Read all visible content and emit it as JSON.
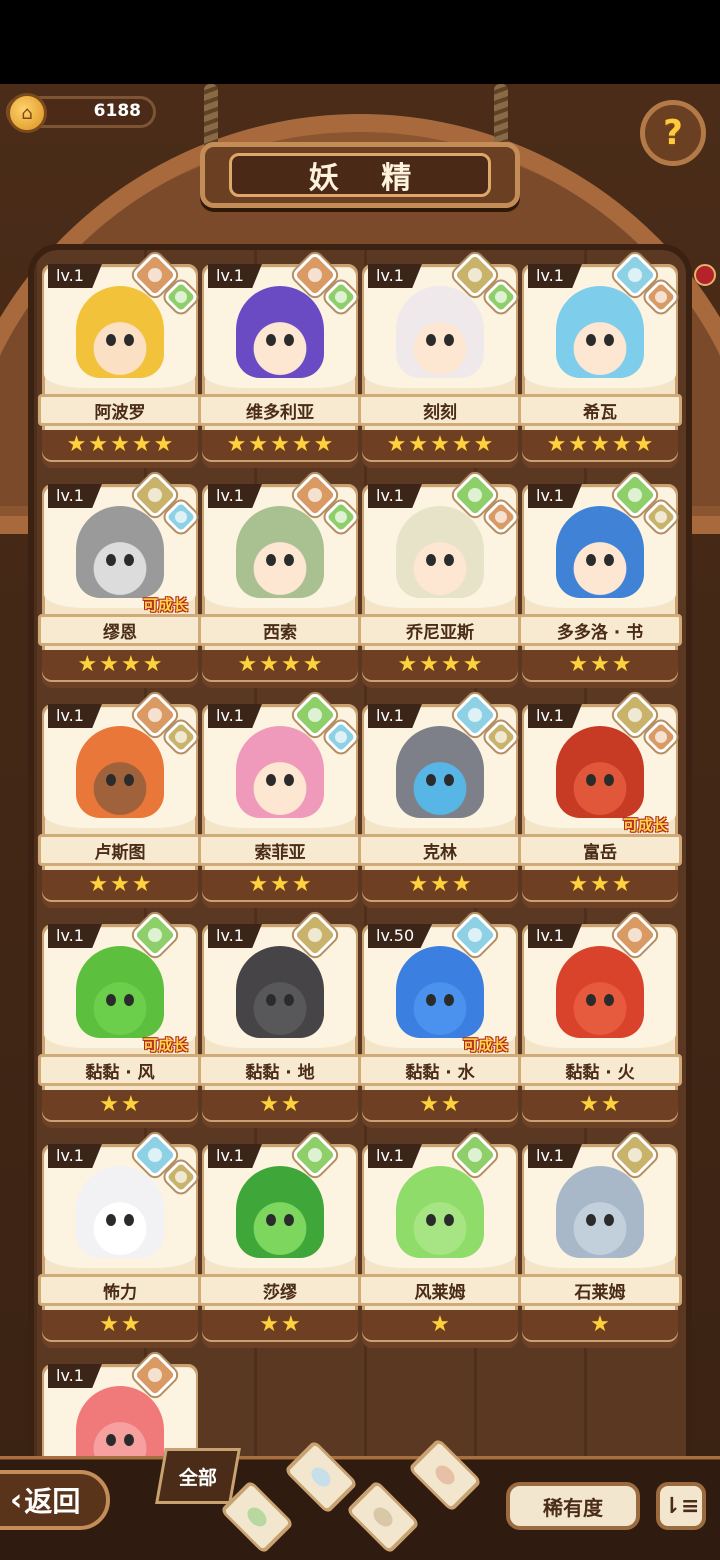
{
  "header": {
    "title": "妖 精",
    "currency_value": "6188",
    "currency_icon": "home-coin-icon",
    "help_icon": "question-bulb-icon"
  },
  "cards": [
    {
      "level": "lv.1",
      "name": "阿波罗",
      "stars": 5,
      "growable": false,
      "hair": "#f1c23a",
      "skin": "#fbe0c3",
      "badge1": "#d99a64",
      "badge2": "#8fcf6a"
    },
    {
      "level": "lv.1",
      "name": "维多利亚",
      "stars": 5,
      "growable": false,
      "hair": "#6a4bc4",
      "skin": "#fde6d2",
      "badge1": "#d99a64",
      "badge2": "#8fcf6a"
    },
    {
      "level": "lv.1",
      "name": "刻刻",
      "stars": 5,
      "growable": false,
      "hair": "#efe9ec",
      "skin": "#fde6d2",
      "badge1": "#c9b26a",
      "badge2": "#8fcf6a"
    },
    {
      "level": "lv.1",
      "name": "希瓦",
      "stars": 5,
      "growable": false,
      "hair": "#7ecdea",
      "skin": "#fde6d2",
      "badge1": "#8ed1e4",
      "badge2": "#d99a64"
    },
    {
      "level": "lv.1",
      "name": "缪恩",
      "stars": 4,
      "growable": true,
      "hair": "#9a9a9a",
      "skin": "#dcdcdc",
      "badge1": "#c9b26a",
      "badge2": "#8ed1e4"
    },
    {
      "level": "lv.1",
      "name": "西索",
      "stars": 4,
      "growable": false,
      "hair": "#a9c090",
      "skin": "#fde6d2",
      "badge1": "#d99a64",
      "badge2": "#8fcf6a"
    },
    {
      "level": "lv.1",
      "name": "乔尼亚斯",
      "stars": 4,
      "growable": false,
      "hair": "#e6e3c8",
      "skin": "#fde6d2",
      "badge1": "#8fcf6a",
      "badge2": "#d99a64"
    },
    {
      "level": "lv.1",
      "name": "多多洛 · 书",
      "stars": 3,
      "growable": false,
      "hair": "#3f82d6",
      "skin": "#fde6d2",
      "badge1": "#8fcf6a",
      "badge2": "#c9b26a"
    },
    {
      "level": "lv.1",
      "name": "卢斯图",
      "stars": 3,
      "growable": false,
      "hair": "#e9773a",
      "skin": "#a0623a",
      "badge1": "#d99a64",
      "badge2": "#c9b26a"
    },
    {
      "level": "lv.1",
      "name": "索菲亚",
      "stars": 3,
      "growable": false,
      "hair": "#f09abb",
      "skin": "#fde6d2",
      "badge1": "#8fcf6a",
      "badge2": "#8ed1e4"
    },
    {
      "level": "lv.1",
      "name": "克林",
      "stars": 3,
      "growable": false,
      "hair": "#7d8088",
      "skin": "#58b6e6",
      "badge1": "#8ed1e4",
      "badge2": "#c9b26a"
    },
    {
      "level": "lv.1",
      "name": "富岳",
      "stars": 3,
      "growable": true,
      "hair": "#c73a24",
      "skin": "#e0573a",
      "badge1": "#c9b26a",
      "badge2": "#d99a64"
    },
    {
      "level": "lv.1",
      "name": "黏黏 · 风",
      "stars": 2,
      "growable": true,
      "hair": "#5cbf3d",
      "skin": "#6ccf4c",
      "badge1": "#8fcf6a",
      "badge2": null
    },
    {
      "level": "lv.1",
      "name": "黏黏 · 地",
      "stars": 2,
      "growable": false,
      "hair": "#464446",
      "skin": "#58575a",
      "badge1": "#c9b26a",
      "badge2": null
    },
    {
      "level": "lv.50",
      "name": "黏黏 · 水",
      "stars": 2,
      "growable": true,
      "hair": "#3b7fe0",
      "skin": "#4a92ee",
      "badge1": "#8ed1e4",
      "badge2": null
    },
    {
      "level": "lv.1",
      "name": "黏黏 · 火",
      "stars": 2,
      "growable": false,
      "hair": "#d9432c",
      "skin": "#e65a3e",
      "badge1": "#d99a64",
      "badge2": null
    },
    {
      "level": "lv.1",
      "name": "怖力",
      "stars": 2,
      "growable": false,
      "hair": "#f2f2f5",
      "skin": "#ffffff",
      "badge1": "#8ed1e4",
      "badge2": "#c9b26a"
    },
    {
      "level": "lv.1",
      "name": "莎缪",
      "stars": 2,
      "growable": false,
      "hair": "#3fa63a",
      "skin": "#7dd65e",
      "badge1": "#8fcf6a",
      "badge2": null
    },
    {
      "level": "lv.1",
      "name": "风莱姆",
      "stars": 1,
      "growable": false,
      "hair": "#8fdc6a",
      "skin": "#a6e484",
      "badge1": "#8fcf6a",
      "badge2": null
    },
    {
      "level": "lv.1",
      "name": "石莱姆",
      "stars": 1,
      "growable": false,
      "hair": "#a8b8c8",
      "skin": "#c2d0dc",
      "badge1": "#c9b26a",
      "badge2": null
    },
    {
      "level": "lv.1",
      "name": "",
      "stars": 0,
      "growable": false,
      "hair": "#f07a7a",
      "skin": "#f6a0a0",
      "badge1": "#d99a64",
      "badge2": null
    }
  ],
  "growable_label": "可成长",
  "star_glyph": "★",
  "footer": {
    "back_label": "返回",
    "all_label": "全部",
    "sort_label": "稀有度",
    "order_glyph": "⇂≡",
    "filters": [
      "water-drop-icon",
      "sprout-icon",
      "mountain-icon",
      "volcano-icon"
    ]
  }
}
